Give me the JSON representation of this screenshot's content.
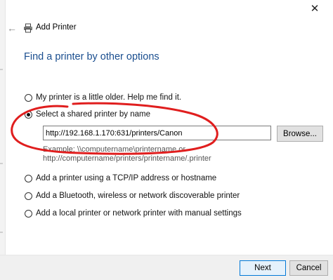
{
  "window": {
    "title": "Add Printer",
    "close_glyph": "✕",
    "back_glyph": "←",
    "icons": {
      "back": "back-arrow-icon",
      "app": "printer-icon",
      "close": "close-icon"
    }
  },
  "page": {
    "heading": "Find a printer by other options"
  },
  "options": [
    {
      "label": "My printer is a little older. Help me find it.",
      "selected": false
    },
    {
      "label": "Select a shared printer by name",
      "selected": true
    },
    {
      "label": "Add a printer using a TCP/IP address or hostname",
      "selected": false
    },
    {
      "label": "Add a Bluetooth, wireless or network discoverable printer",
      "selected": false
    },
    {
      "label": "Add a local printer or network printer with manual settings",
      "selected": false
    }
  ],
  "shared_printer": {
    "value": "http://192.168.1.170:631/printers/Canon",
    "browse_label": "Browse...",
    "example_line1": "Example: \\\\computername\\printername or",
    "example_line2": "http://computername/printers/printername/.printer"
  },
  "footer": {
    "next_label": "Next",
    "cancel_label": "Cancel"
  },
  "colors": {
    "heading": "#1a4e8f",
    "annotation": "#e01e1e",
    "primary_button_border": "#0078d7"
  }
}
